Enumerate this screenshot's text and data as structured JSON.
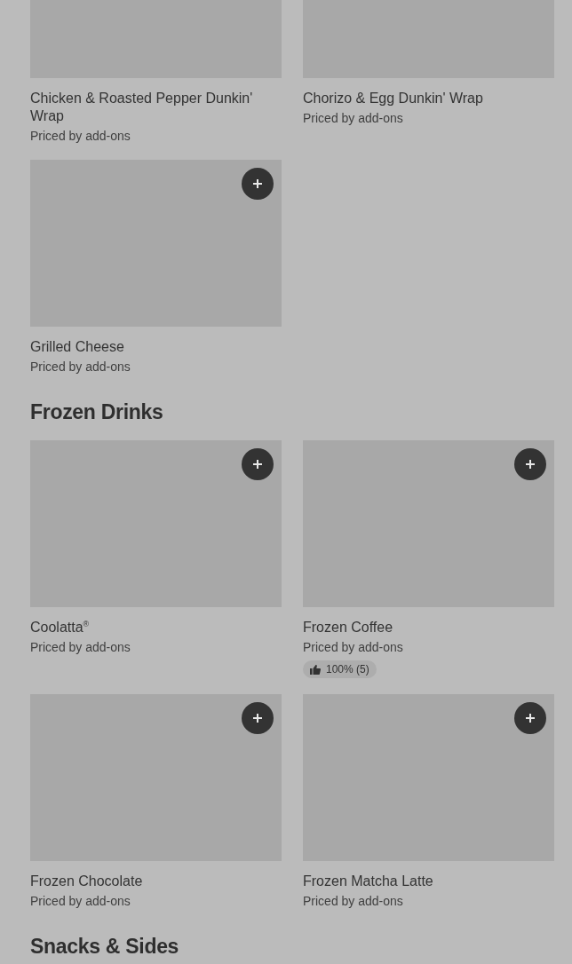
{
  "sections": [
    {
      "items": [
        {
          "name": "Chicken & Roasted Pepper Dunkin' Wrap",
          "price": "Priced by add-ons"
        },
        {
          "name": "Chorizo & Egg Dunkin' Wrap",
          "price": "Priced by add-ons"
        },
        {
          "name": "Grilled Cheese",
          "price": "Priced by add-ons",
          "add_button": true
        }
      ]
    },
    {
      "title": "Frozen Drinks",
      "items": [
        {
          "name": "Coolatta$^{®}$",
          "price": "Priced by add-ons",
          "add_button": true
        },
        {
          "name": "Frozen Coffee",
          "price": "Priced by add-ons",
          "rating": "100% (5)",
          "add_button": true
        },
        {
          "name": "Frozen Chocolate",
          "price": "Priced by add-ons",
          "add_button": true
        },
        {
          "name": "Frozen Matcha Latte",
          "price": "Priced by add-ons",
          "add_button": true
        }
      ]
    },
    {
      "title": "Snacks & Sides"
    }
  ]
}
